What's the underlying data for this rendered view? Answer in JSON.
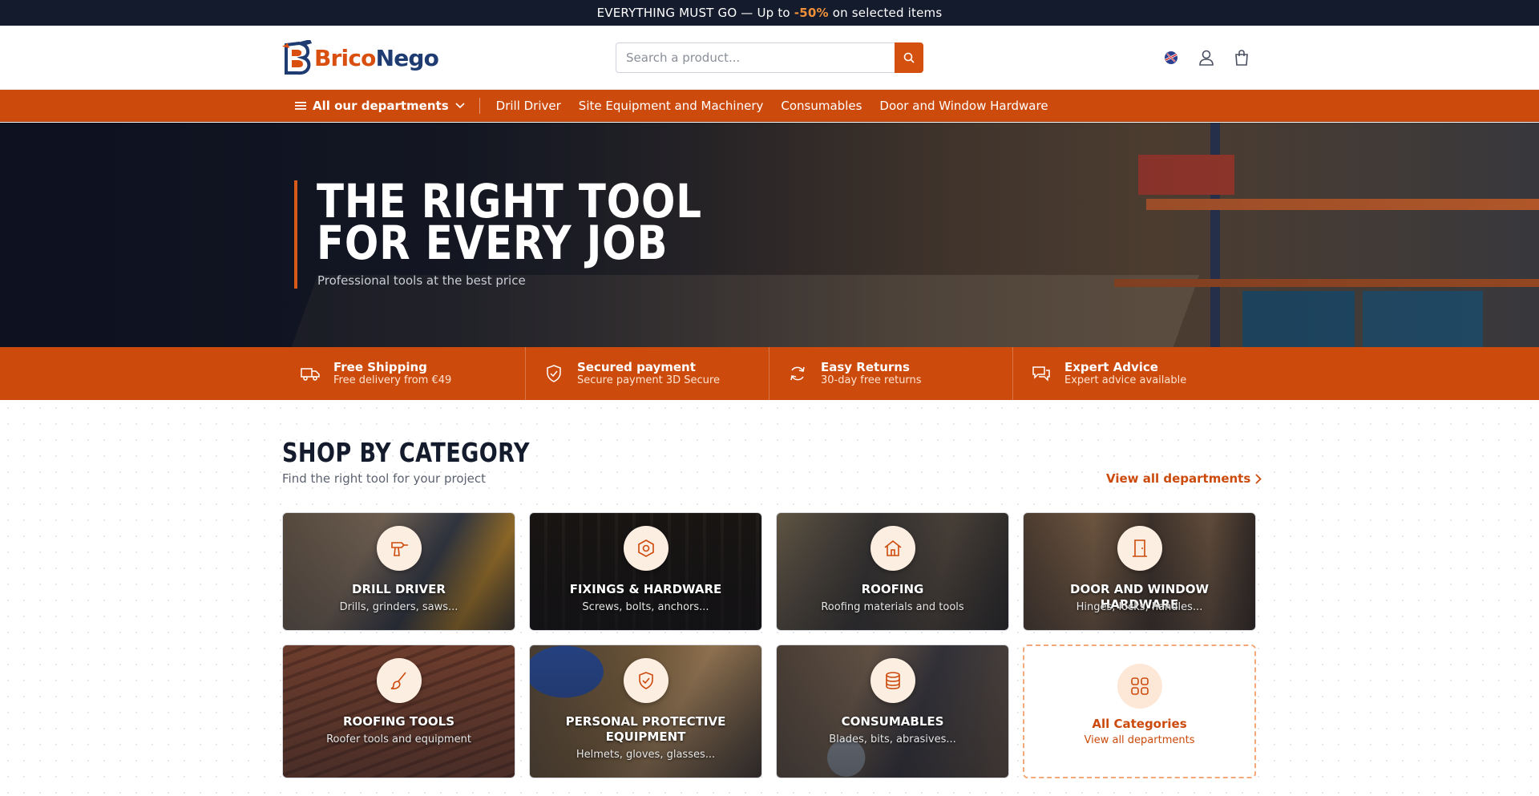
{
  "promo": {
    "prefix": "EVERYTHING MUST GO — Up to",
    "highlight": "-50%",
    "suffix": "on selected items"
  },
  "header": {
    "logo_part1": "Brico",
    "logo_part2": "Nego",
    "search_placeholder": "Search a product...",
    "icons": [
      "language-flag-icon",
      "user-icon",
      "cart-icon"
    ]
  },
  "nav": {
    "all_departments": "All our departments",
    "links": [
      "Drill Driver",
      "Site Equipment and Machinery",
      "Consumables",
      "Door and Window Hardware"
    ]
  },
  "hero": {
    "title_line1": "THE RIGHT TOOL",
    "title_line2": "FOR EVERY JOB",
    "subtitle": "Professional tools at the best price"
  },
  "features": [
    {
      "title": "Free Shipping",
      "subtitle": "Free delivery from €49",
      "icon": "truck-icon"
    },
    {
      "title": "Secured payment",
      "subtitle": "Secure payment 3D Secure",
      "icon": "shield-check-icon"
    },
    {
      "title": "Easy Returns",
      "subtitle": "30-day free returns",
      "icon": "refresh-icon"
    },
    {
      "title": "Expert Advice",
      "subtitle": "Expert advice available",
      "icon": "chat-icon"
    }
  ],
  "categories_section": {
    "title": "SHOP BY CATEGORY",
    "subtitle": "Find the right tool for your project",
    "view_all": "View all departments",
    "cards": [
      {
        "title": "DRILL DRIVER",
        "subtitle": "Drills, grinders, saws...",
        "icon": "drill-icon"
      },
      {
        "title": "FIXINGS & HARDWARE",
        "subtitle": "Screws, bolts, anchors...",
        "icon": "hex-nut-icon"
      },
      {
        "title": "ROOFING",
        "subtitle": "Roofing materials and tools",
        "icon": "house-icon"
      },
      {
        "title": "DOOR AND WINDOW HARDWARE",
        "subtitle": "Hinges, locks, handles...",
        "icon": "door-icon"
      },
      {
        "title": "ROOFING TOOLS",
        "subtitle": "Roofer tools and equipment",
        "icon": "brush-icon"
      },
      {
        "title": "PERSONAL PROTECTIVE EQUIPMENT",
        "subtitle": "Helmets, gloves, glasses...",
        "icon": "shield-check-icon"
      },
      {
        "title": "CONSUMABLES",
        "subtitle": "Blades, bits, abrasives...",
        "icon": "database-icon"
      }
    ],
    "all_card": {
      "title": "All Categories",
      "subtitle": "View all departments",
      "icon": "grid-icon"
    }
  },
  "colors": {
    "accent": "#cc4a0c",
    "dark": "#141b2d",
    "promo_highlight": "#f0913a"
  }
}
